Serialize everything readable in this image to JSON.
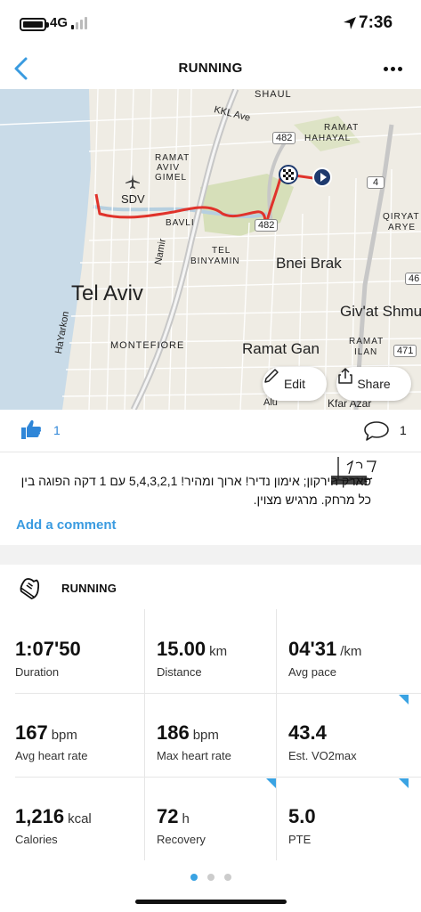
{
  "status": {
    "network": "4G",
    "time": "7:36"
  },
  "nav": {
    "title": "RUNNING",
    "back_icon": "chevron-left-icon",
    "more_icon": "more-dots-icon"
  },
  "map": {
    "labels": {
      "shaul": "SHAUL",
      "kkl": "KKL Ave",
      "road_482": "482",
      "road_482_b": "482",
      "ramat_hahayal_1": "RAMAT",
      "ramat_hahayal_2": "HAHAYAL",
      "ramat_aviv_1": "RAMAT",
      "ramat_aviv_2": "AVIV",
      "ramat_aviv_3": "GIMEL",
      "sdv": "SDV",
      "road_4": "4",
      "qiryat_1": "QIRYAT",
      "qiryat_2": "ARYE",
      "bavli": "BAVLI",
      "namir": "Namir",
      "tel_binyamin_1": "TEL",
      "tel_binyamin_2": "BINYAMIN",
      "bnei_brak": "Bnei Brak",
      "road_46": "46",
      "tel_aviv": "Tel Aviv",
      "hayarkon": "HaYarkon",
      "givat_shmuel": "Giv'at Shmu",
      "montefiore": "MONTEFIORE",
      "ramat_gan": "Ramat Gan",
      "ramat_ilan_1": "RAMAT",
      "ramat_ilan_2": "ILAN",
      "road_471": "471",
      "kfar_azar": "Kfar Azar",
      "alu": "Alu"
    },
    "edit_label": "Edit",
    "share_label": "Share",
    "route_color": "#e0332b"
  },
  "social": {
    "likes": "1",
    "comments": "1"
  },
  "description": {
    "text": "פארק הירקון; אימון נדיר! ארוך ומהיר! 5,4,3,2,1 עם 1 דקה הפוגה בין כל מרחק. מרגיש מצוין.",
    "add_comment": "Add a comment"
  },
  "sport": {
    "label": "RUNNING",
    "icon": "running-shoe-icon"
  },
  "stats": [
    {
      "value": "1:07'50",
      "unit": "",
      "label": "Duration",
      "flag": false
    },
    {
      "value": "15.00",
      "unit": "km",
      "label": "Distance",
      "flag": false
    },
    {
      "value": "04'31",
      "unit": "/km",
      "label": "Avg pace",
      "flag": true
    },
    {
      "value": "167",
      "unit": "bpm",
      "label": "Avg heart rate",
      "flag": false
    },
    {
      "value": "186",
      "unit": "bpm",
      "label": "Max heart rate",
      "flag": false
    },
    {
      "value": "43.4",
      "unit": "",
      "label": "Est. VO2max",
      "flag": true
    },
    {
      "value": "1,216",
      "unit": "kcal",
      "label": "Calories",
      "flag": false
    },
    {
      "value": "72",
      "unit": "h",
      "label": "Recovery",
      "flag": true
    },
    {
      "value": "5.0",
      "unit": "",
      "label": "PTE",
      "flag": true
    }
  ],
  "pager": {
    "count": 3,
    "active": 0
  },
  "colors": {
    "accent": "#3aa3e3",
    "link": "#3a9be0",
    "like": "#2f86d8"
  }
}
